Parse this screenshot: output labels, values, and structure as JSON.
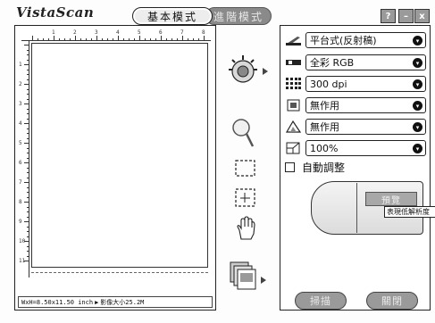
{
  "app": {
    "title": "VistaScan"
  },
  "modes": {
    "basic": "基本模式",
    "advanced": "進階模式"
  },
  "window": {
    "help": "?",
    "minimize": "–",
    "close": "x"
  },
  "preview": {
    "status_size": "WxH=8.50x11.50 inch",
    "status_image": "影像大小25.2M",
    "ruler_top_numbers": [
      "1",
      "2",
      "3",
      "4",
      "5",
      "6",
      "7",
      "8"
    ],
    "ruler_left_numbers": [
      "1",
      "2",
      "3",
      "4",
      "5",
      "6",
      "7",
      "8",
      "9",
      "10",
      "11"
    ]
  },
  "tools": [
    {
      "name": "scanner-wheel-icon"
    },
    {
      "name": "magnifier-icon"
    },
    {
      "name": "select-frame-icon"
    },
    {
      "name": "crosshair-frame-icon"
    },
    {
      "name": "hand-icon"
    },
    {
      "name": "multi-page-icon"
    }
  ],
  "settings": {
    "source": "平台式(反射稿)",
    "color_mode": "全彩 RGB",
    "resolution": "300 dpi",
    "filter": "無作用",
    "descreen": "無作用",
    "scale": "100%",
    "auto_adjust_label": "自動調整",
    "auto_adjust_checked": false
  },
  "preview_button": {
    "label": "預覽",
    "tooltip": "表現低解析度"
  },
  "buttons": {
    "scan": "掃描",
    "close": "關閉"
  }
}
